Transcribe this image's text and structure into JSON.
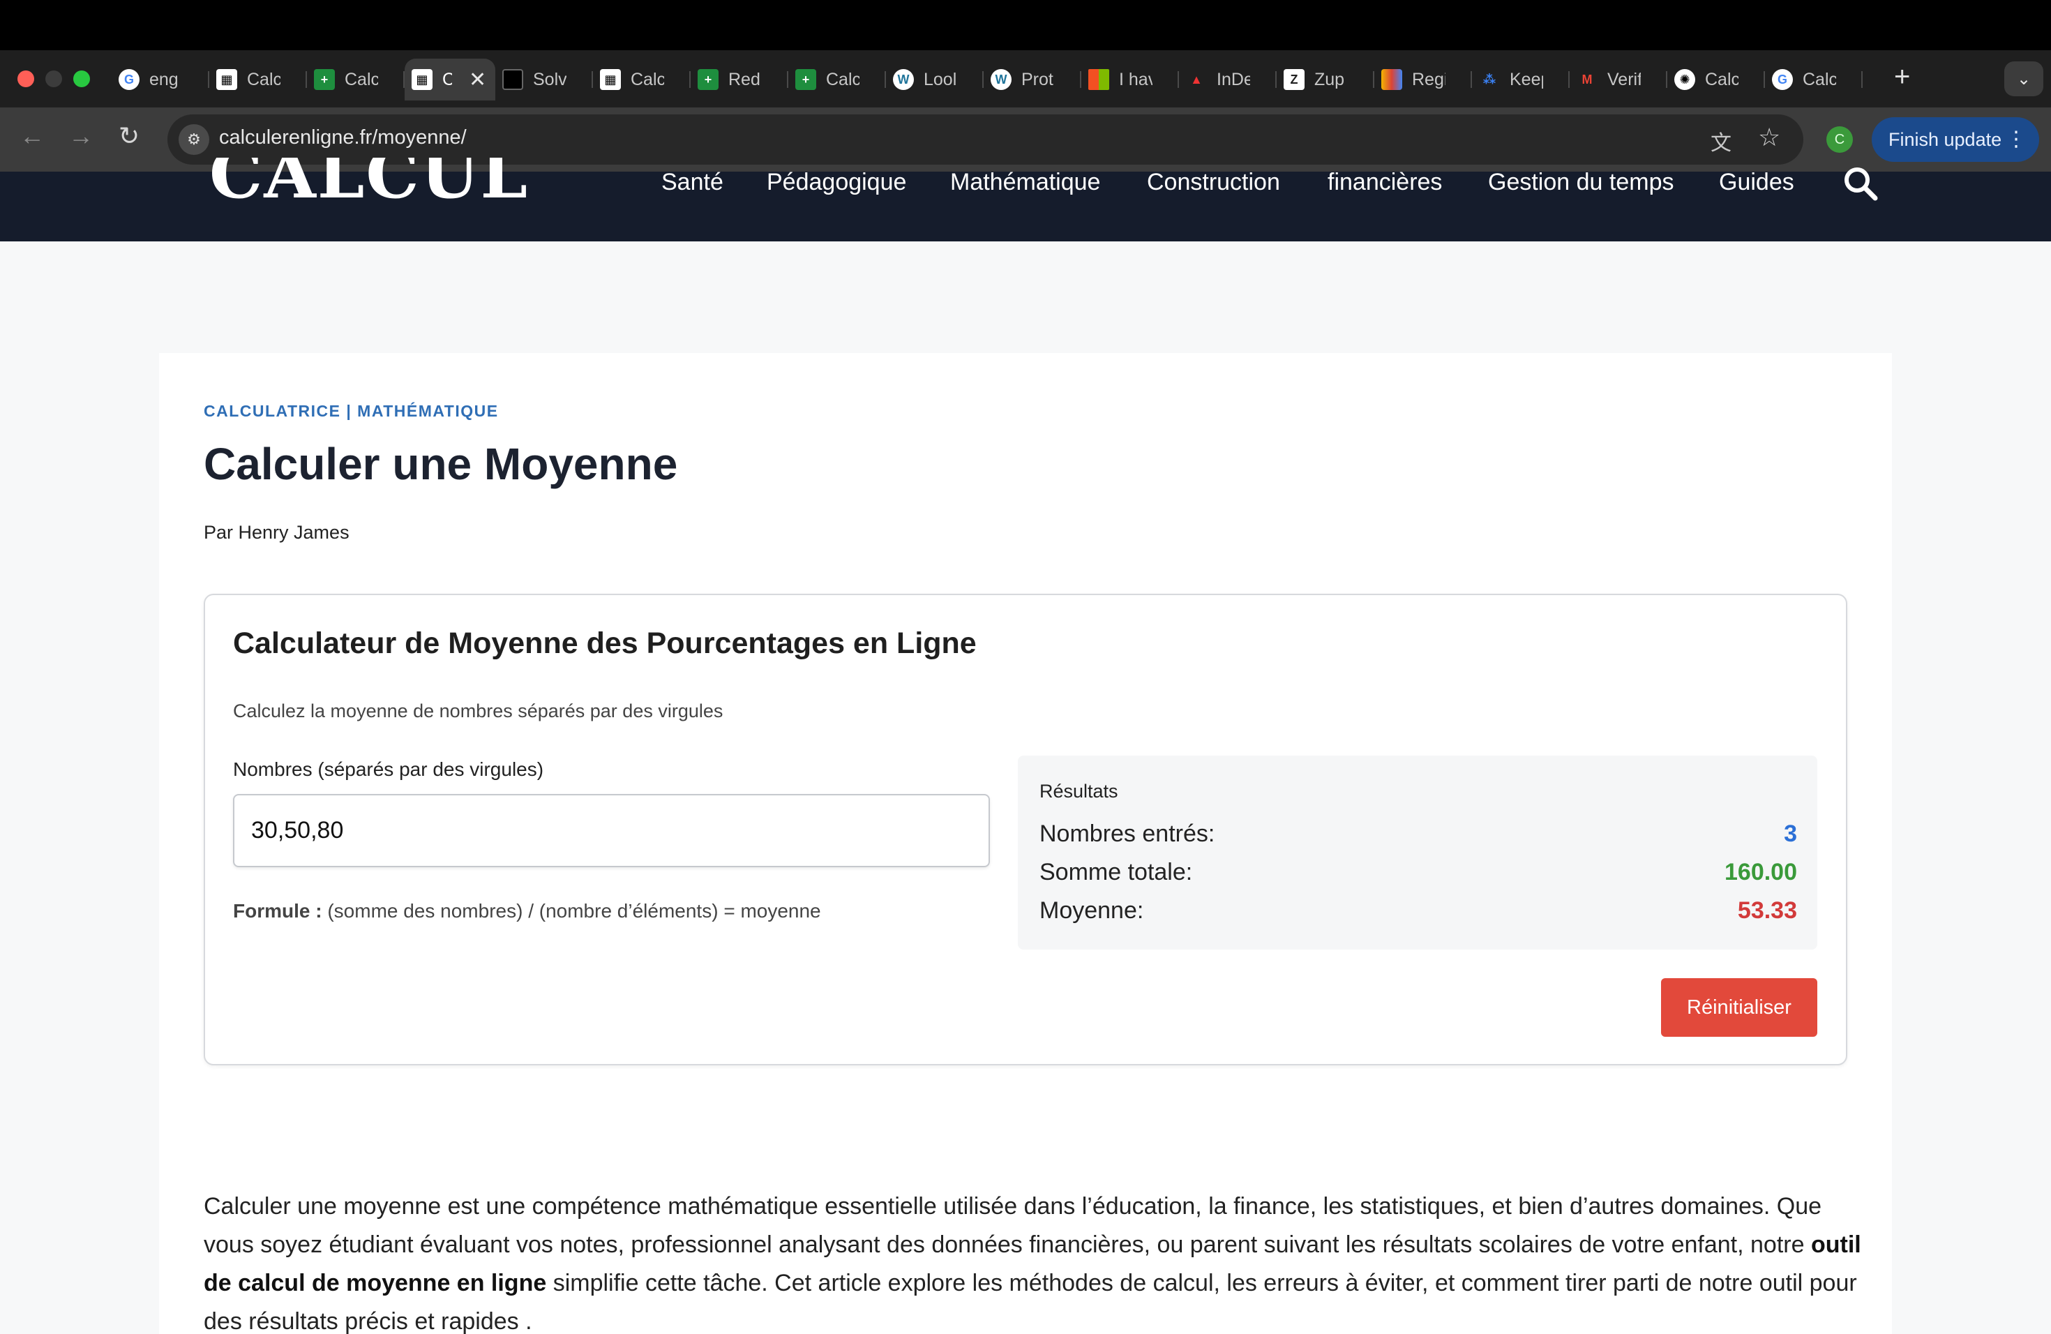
{
  "browser": {
    "tabs": [
      {
        "title": "eng",
        "icon": "google-icon"
      },
      {
        "title": "Calc",
        "icon": "calculator-icon"
      },
      {
        "title": "Calc",
        "icon": "sheets-icon"
      },
      {
        "title": "C",
        "icon": "calculator-icon",
        "active": true
      },
      {
        "title": "Solv",
        "icon": "solver-icon"
      },
      {
        "title": "Calc",
        "icon": "calculator-icon"
      },
      {
        "title": "Red",
        "icon": "sheets-icon"
      },
      {
        "title": "Calc",
        "icon": "sheets-icon"
      },
      {
        "title": "Lool",
        "icon": "wordpress-icon"
      },
      {
        "title": "Prot",
        "icon": "wordpress-icon"
      },
      {
        "title": "I hav",
        "icon": "microsoft-icon"
      },
      {
        "title": "InDe",
        "icon": "indeed-icon"
      },
      {
        "title": "Zup",
        "icon": "zup-icon"
      },
      {
        "title": "Regi",
        "icon": "registry-icon"
      },
      {
        "title": "Keep",
        "icon": "keep-icon"
      },
      {
        "title": "Verif",
        "icon": "gmail-icon"
      },
      {
        "title": "Calc",
        "icon": "openai-icon"
      },
      {
        "title": "Calc",
        "icon": "google-icon"
      }
    ],
    "url": "calculerenligne.fr/moyenne/",
    "profile_initial": "C",
    "finish_update": "Finish update"
  },
  "site": {
    "logo": "CALCUL",
    "nav": [
      "Santé",
      "Pédagogique",
      "Mathématique",
      "Construction",
      "financières",
      "Gestion du temps",
      "Guides"
    ]
  },
  "page": {
    "category_a": "CALCULATRICE",
    "category_sep": " | ",
    "category_b": "MATHÉMATIQUE",
    "title": "Calculer une Moyenne",
    "byline": "Par Henry James"
  },
  "calculator": {
    "title": "Calculateur de Moyenne des Pourcentages en Ligne",
    "subtitle": "Calculez la moyenne de nombres séparés par des virgules",
    "input_label": "Nombres (séparés par des virgules)",
    "input_value": "30,50,80",
    "formula_label": "Formule :",
    "formula_text": " (somme des nombres) / (nombre d’éléments) = moyenne",
    "results_title": "Résultats",
    "results": [
      {
        "label": "Nombres entrés:",
        "value": "3",
        "color": "#2b6fd6"
      },
      {
        "label": "Somme totale:",
        "value": "160.00",
        "color": "#3a9a3a"
      },
      {
        "label": "Moyenne:",
        "value": "53.33",
        "color": "#d23a3a"
      }
    ],
    "reset_label": "Réinitialiser"
  },
  "article": {
    "p1_a": "Calculer une moyenne est une compétence mathématique essentielle utilisée dans l’éducation, la finance, les statistiques, et bien d’autres domaines. Que vous soyez étudiant évaluant vos notes, professionnel analysant des données financières, ou parent suivant les résultats scolaires de votre enfant, notre ",
    "p1_bold": "outil de calcul de moyenne en ligne",
    "p1_b": " simplifie cette tâche. Cet article explore les méthodes de calcul, les erreurs à éviter, et comment tirer parti de notre outil pour des résultats précis et rapides ."
  }
}
